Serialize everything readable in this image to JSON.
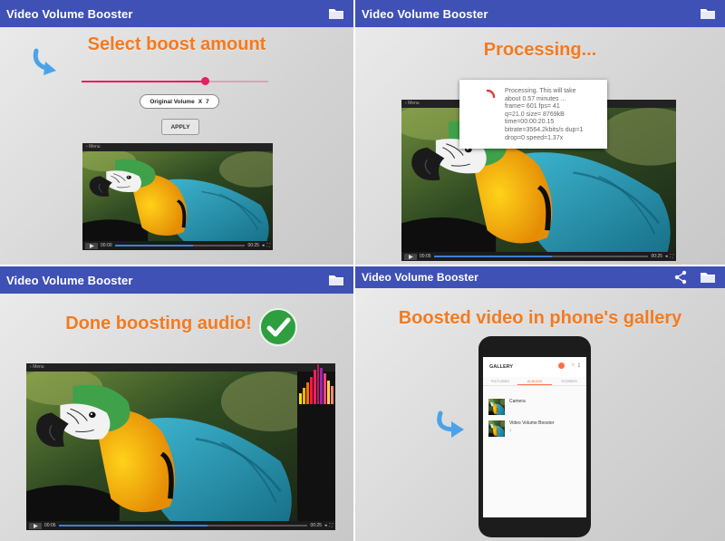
{
  "app_title": "Video Volume Booster",
  "colors": {
    "appbar": "#3f51b5",
    "heading": "#f47a1f",
    "accent": "#e91e63",
    "check": "#2e9e3e"
  },
  "panel1": {
    "heading": "Select boost amount",
    "slider_value_fraction": 0.66,
    "original_volume_label": "Original Volume",
    "multiplier": "X",
    "boost_value": "7",
    "apply_label": "APPLY",
    "player": {
      "menu": "Menu",
      "elapsed": "00:00",
      "duration": "00:25",
      "progress": 0.6
    }
  },
  "panel2": {
    "heading": "Processing...",
    "dialog_lines": [
      "Processing. This will take",
      "about 0.57 minutes ...",
      "frame=  601 fps= 41",
      "q=21.0 size=    8769kB",
      "time=00:00:20.15",
      "bitrate=3564.2kbits/s dup=1",
      "drop=0 speed=1.37x"
    ],
    "player": {
      "menu": "Menu",
      "elapsed": "00:05",
      "duration": "00:25",
      "progress": 0.55
    }
  },
  "panel3": {
    "heading": "Done boosting audio!",
    "player": {
      "menu": "Menu",
      "elapsed": "00:06",
      "duration": "00:25",
      "progress": 0.6
    }
  },
  "panel4": {
    "heading": "Boosted video in phone's gallery",
    "gallery": {
      "title": "GALLERY",
      "tabs": [
        "PICTURES",
        "ALBUMS",
        "STORIES"
      ],
      "active_tab": 1,
      "albums": [
        {
          "name": "Camera",
          "count": ""
        },
        {
          "name": "Video Volume Booster",
          "count": "1"
        }
      ]
    }
  },
  "icons": [
    "folder-icon",
    "share-icon",
    "curved-arrow-icon",
    "check-icon",
    "play-icon",
    "volume-icon",
    "fullscreen-icon",
    "spinner-icon"
  ]
}
